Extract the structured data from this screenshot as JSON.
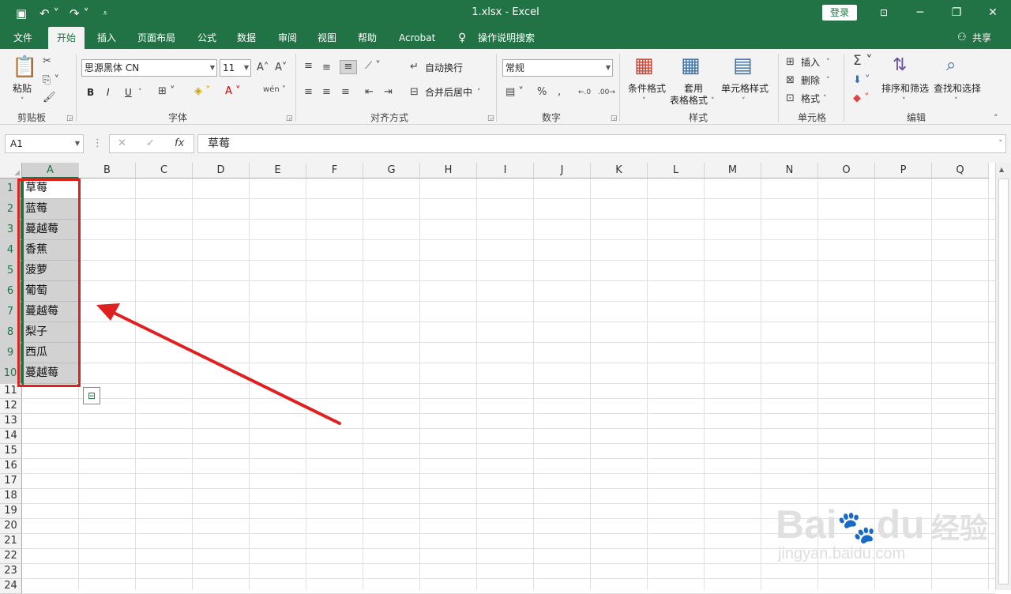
{
  "app": {
    "doc_title": "1.xlsx  -  Excel",
    "login_label": "登录"
  },
  "tabs": [
    "文件",
    "开始",
    "插入",
    "页面布局",
    "公式",
    "数据",
    "审阅",
    "视图",
    "帮助",
    "Acrobat"
  ],
  "tell_me": "操作说明搜索",
  "share_label": "共享",
  "ribbon": {
    "clipboard": {
      "paste": "粘贴",
      "group": "剪贴板"
    },
    "font": {
      "family": "思源黑体 CN",
      "size": "11",
      "bold": "B",
      "italic": "I",
      "underline": "U",
      "group": "字体"
    },
    "alignment": {
      "wrap": "自动换行",
      "merge": "合并后居中",
      "group": "对齐方式"
    },
    "number": {
      "format": "常规",
      "group": "数字"
    },
    "styles": {
      "conditional": "条件格式",
      "table_line1": "套用",
      "table_line2": "表格格式",
      "cell_styles": "单元格样式",
      "group": "样式"
    },
    "cells": {
      "insert": "插入",
      "delete": "删除",
      "format": "格式",
      "group": "单元格"
    },
    "editing": {
      "sort": "排序和筛选",
      "find": "查找和选择",
      "group": "编辑"
    }
  },
  "formula_bar": {
    "name_box": "A1",
    "fx": "fx",
    "value": "草莓"
  },
  "columns": [
    "A",
    "B",
    "C",
    "D",
    "E",
    "F",
    "G",
    "H",
    "I",
    "J",
    "K",
    "L",
    "M",
    "N",
    "O",
    "P",
    "Q"
  ],
  "rows": [
    "1",
    "2",
    "3",
    "4",
    "5",
    "6",
    "7",
    "8",
    "9",
    "10",
    "11",
    "12",
    "13",
    "14",
    "15",
    "16",
    "17",
    "18",
    "19",
    "20",
    "21",
    "22",
    "23",
    "24"
  ],
  "cells_A": [
    "草莓",
    "蓝莓",
    "蔓越莓",
    "香蕉",
    "菠萝",
    "葡萄",
    "蔓越莓",
    "梨子",
    "西瓜",
    "蔓越莓"
  ],
  "watermark": {
    "brand": "Bai",
    "brand2": "du",
    "cn": "经验",
    "url": "jingyan.baidu.com"
  },
  "colors": {
    "excel_green": "#217346",
    "highlight_red": "#e02020",
    "selection_gray": "#d2d2d2"
  }
}
